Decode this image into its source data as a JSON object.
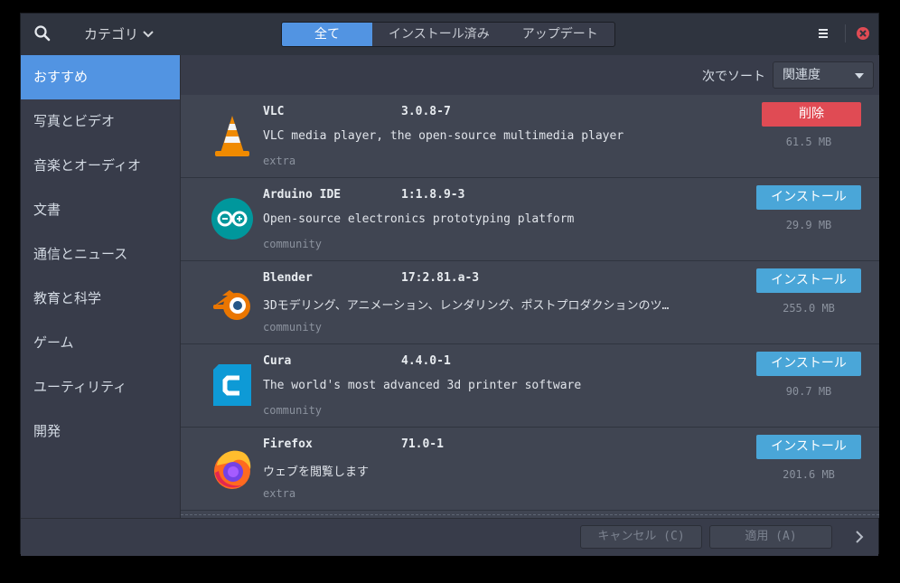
{
  "header": {
    "category_label": "カテゴリ",
    "tabs": [
      "全て",
      "インストール済み",
      "アップデート"
    ],
    "active_tab": 0
  },
  "sidebar": {
    "items": [
      {
        "label": "おすすめ"
      },
      {
        "label": "写真とビデオ"
      },
      {
        "label": "音楽とオーディオ"
      },
      {
        "label": "文書"
      },
      {
        "label": "通信とニュース"
      },
      {
        "label": "教育と科学"
      },
      {
        "label": "ゲーム"
      },
      {
        "label": "ユーティリティ"
      },
      {
        "label": "開発"
      }
    ],
    "active_index": 0
  },
  "sort": {
    "label": "次でソート",
    "value": "関連度"
  },
  "apps": [
    {
      "name": "VLC",
      "version": "3.0.8-7",
      "description": "VLC media player, the open-source multimedia player",
      "repo": "extra",
      "action": "削除",
      "size": "61.5 MB",
      "icon": "vlc-icon"
    },
    {
      "name": "Arduino IDE",
      "version": "1:1.8.9-3",
      "description": "Open-source electronics prototyping platform",
      "repo": "community",
      "action": "インストール",
      "size": "29.9 MB",
      "icon": "arduino-icon"
    },
    {
      "name": "Blender",
      "version": "17:2.81.a-3",
      "description": "3Dモデリング、アニメーション、レンダリング、ポストプロダクションのツ…",
      "repo": "community",
      "action": "インストール",
      "size": "255.0 MB",
      "icon": "blender-icon"
    },
    {
      "name": "Cura",
      "version": "4.4.0-1",
      "description": "The world's most advanced 3d printer software",
      "repo": "community",
      "action": "インストール",
      "size": "90.7 MB",
      "icon": "cura-icon"
    },
    {
      "name": "Firefox",
      "version": "71.0-1",
      "description": "ウェブを閲覧します",
      "repo": "extra",
      "action": "インストール",
      "size": "201.6 MB",
      "icon": "firefox-icon"
    }
  ],
  "footer": {
    "cancel_label": "キャンセル (C)",
    "apply_label": "適用 (A)"
  },
  "colors": {
    "accent": "#5294e2",
    "install": "#4aa6d8",
    "remove": "#e04b54"
  }
}
